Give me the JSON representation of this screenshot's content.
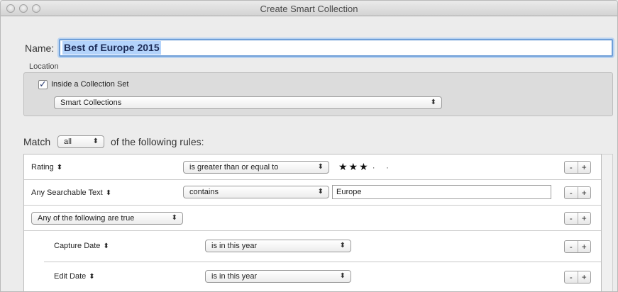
{
  "window": {
    "title": "Create Smart Collection"
  },
  "name": {
    "label": "Name:",
    "value": "Best of Europe 2015"
  },
  "location": {
    "label": "Location",
    "inside_set_label": "Inside a Collection Set",
    "inside_set_checked": true,
    "check_glyph": "✓",
    "collection_set": "Smart Collections"
  },
  "match": {
    "prefix": "Match",
    "mode": "all",
    "suffix": "of the following rules:"
  },
  "popup_arrows": "⬍",
  "rules": [
    {
      "field": "Rating",
      "operator": "is greater than or equal to",
      "stars_filled": 3,
      "stars_total": 5,
      "stars_text": "★★★",
      "empty_dots": "· ·"
    },
    {
      "field": "Any Searchable Text",
      "operator": "contains",
      "value": "Europe"
    },
    {
      "group": "Any of the following are true",
      "children": [
        {
          "field": "Capture Date",
          "operator": "is in this year"
        },
        {
          "field": "Edit Date",
          "operator": "is in this year"
        }
      ]
    }
  ],
  "buttons": {
    "remove": "-",
    "add": "+"
  }
}
